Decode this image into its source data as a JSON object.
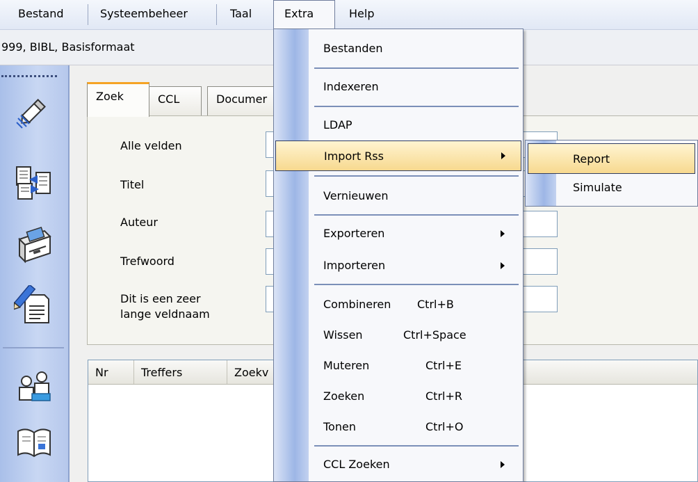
{
  "menubar": {
    "items": [
      "Bestand",
      "Systeembeheer",
      "Taal",
      "Extra",
      "Help"
    ]
  },
  "info_line": "999, BIBL, Basisformaat",
  "tabs": [
    "Zoek",
    "CCL",
    "Documer"
  ],
  "search_fields": [
    "Alle velden",
    "Titel",
    "Auteur",
    "Trefwoord",
    "Dit is een zeer\nlange veldnaam"
  ],
  "results_grid": {
    "columns": [
      "Nr",
      "Treffers",
      "Zoekv"
    ]
  },
  "extra_menu": {
    "items": [
      {
        "label": "Bestanden"
      },
      {
        "label": "Indexeren"
      },
      {
        "label": "LDAP"
      },
      {
        "label": "Import Rss",
        "has_submenu": true,
        "highlighted": true
      },
      {
        "label": "Vernieuwen"
      },
      {
        "label": "Exporteren",
        "has_submenu": true
      },
      {
        "label": "Importeren",
        "has_submenu": true
      },
      {
        "label": "Combineren",
        "shortcut": "Ctrl+B"
      },
      {
        "label": "Wissen",
        "shortcut": "Ctrl+Space"
      },
      {
        "label": "Muteren",
        "shortcut": "Ctrl+E"
      },
      {
        "label": "Zoeken",
        "shortcut": "Ctrl+R"
      },
      {
        "label": "Tonen",
        "shortcut": "Ctrl+O"
      },
      {
        "label": "CCL Zoeken",
        "has_submenu": true
      }
    ]
  },
  "import_rss_submenu": {
    "items": [
      {
        "label": "Report",
        "highlighted": true
      },
      {
        "label": "Simulate"
      }
    ]
  },
  "toolbar_icons": [
    "pencil-icon",
    "records-exchange-icon",
    "card-drawer-icon",
    "edit-document-icon",
    "users-icon",
    "open-book-icon"
  ],
  "colors": {
    "menu_highlight": "#f7d98f",
    "menu_gutter": "#9db6e6",
    "active_tab_accent": "#f5a324",
    "toolbar_blue": "#b6c8ec"
  }
}
